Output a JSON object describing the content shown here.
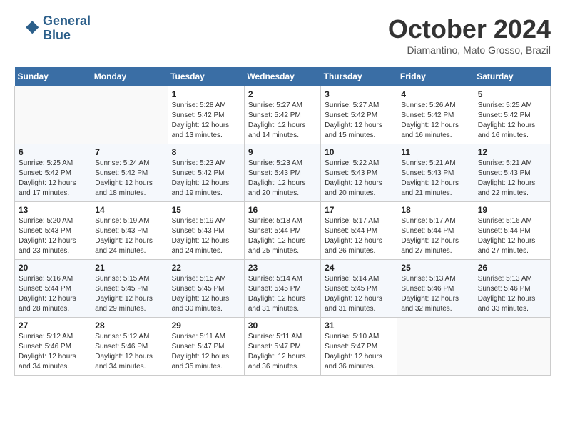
{
  "logo": {
    "line1": "General",
    "line2": "Blue"
  },
  "title": "October 2024",
  "location": "Diamantino, Mato Grosso, Brazil",
  "days_header": [
    "Sunday",
    "Monday",
    "Tuesday",
    "Wednesday",
    "Thursday",
    "Friday",
    "Saturday"
  ],
  "weeks": [
    [
      {
        "day": "",
        "info": ""
      },
      {
        "day": "",
        "info": ""
      },
      {
        "day": "1",
        "info": "Sunrise: 5:28 AM\nSunset: 5:42 PM\nDaylight: 12 hours and 13 minutes."
      },
      {
        "day": "2",
        "info": "Sunrise: 5:27 AM\nSunset: 5:42 PM\nDaylight: 12 hours and 14 minutes."
      },
      {
        "day": "3",
        "info": "Sunrise: 5:27 AM\nSunset: 5:42 PM\nDaylight: 12 hours and 15 minutes."
      },
      {
        "day": "4",
        "info": "Sunrise: 5:26 AM\nSunset: 5:42 PM\nDaylight: 12 hours and 16 minutes."
      },
      {
        "day": "5",
        "info": "Sunrise: 5:25 AM\nSunset: 5:42 PM\nDaylight: 12 hours and 16 minutes."
      }
    ],
    [
      {
        "day": "6",
        "info": "Sunrise: 5:25 AM\nSunset: 5:42 PM\nDaylight: 12 hours and 17 minutes."
      },
      {
        "day": "7",
        "info": "Sunrise: 5:24 AM\nSunset: 5:42 PM\nDaylight: 12 hours and 18 minutes."
      },
      {
        "day": "8",
        "info": "Sunrise: 5:23 AM\nSunset: 5:42 PM\nDaylight: 12 hours and 19 minutes."
      },
      {
        "day": "9",
        "info": "Sunrise: 5:23 AM\nSunset: 5:43 PM\nDaylight: 12 hours and 20 minutes."
      },
      {
        "day": "10",
        "info": "Sunrise: 5:22 AM\nSunset: 5:43 PM\nDaylight: 12 hours and 20 minutes."
      },
      {
        "day": "11",
        "info": "Sunrise: 5:21 AM\nSunset: 5:43 PM\nDaylight: 12 hours and 21 minutes."
      },
      {
        "day": "12",
        "info": "Sunrise: 5:21 AM\nSunset: 5:43 PM\nDaylight: 12 hours and 22 minutes."
      }
    ],
    [
      {
        "day": "13",
        "info": "Sunrise: 5:20 AM\nSunset: 5:43 PM\nDaylight: 12 hours and 23 minutes."
      },
      {
        "day": "14",
        "info": "Sunrise: 5:19 AM\nSunset: 5:43 PM\nDaylight: 12 hours and 24 minutes."
      },
      {
        "day": "15",
        "info": "Sunrise: 5:19 AM\nSunset: 5:43 PM\nDaylight: 12 hours and 24 minutes."
      },
      {
        "day": "16",
        "info": "Sunrise: 5:18 AM\nSunset: 5:44 PM\nDaylight: 12 hours and 25 minutes."
      },
      {
        "day": "17",
        "info": "Sunrise: 5:17 AM\nSunset: 5:44 PM\nDaylight: 12 hours and 26 minutes."
      },
      {
        "day": "18",
        "info": "Sunrise: 5:17 AM\nSunset: 5:44 PM\nDaylight: 12 hours and 27 minutes."
      },
      {
        "day": "19",
        "info": "Sunrise: 5:16 AM\nSunset: 5:44 PM\nDaylight: 12 hours and 27 minutes."
      }
    ],
    [
      {
        "day": "20",
        "info": "Sunrise: 5:16 AM\nSunset: 5:44 PM\nDaylight: 12 hours and 28 minutes."
      },
      {
        "day": "21",
        "info": "Sunrise: 5:15 AM\nSunset: 5:45 PM\nDaylight: 12 hours and 29 minutes."
      },
      {
        "day": "22",
        "info": "Sunrise: 5:15 AM\nSunset: 5:45 PM\nDaylight: 12 hours and 30 minutes."
      },
      {
        "day": "23",
        "info": "Sunrise: 5:14 AM\nSunset: 5:45 PM\nDaylight: 12 hours and 31 minutes."
      },
      {
        "day": "24",
        "info": "Sunrise: 5:14 AM\nSunset: 5:45 PM\nDaylight: 12 hours and 31 minutes."
      },
      {
        "day": "25",
        "info": "Sunrise: 5:13 AM\nSunset: 5:46 PM\nDaylight: 12 hours and 32 minutes."
      },
      {
        "day": "26",
        "info": "Sunrise: 5:13 AM\nSunset: 5:46 PM\nDaylight: 12 hours and 33 minutes."
      }
    ],
    [
      {
        "day": "27",
        "info": "Sunrise: 5:12 AM\nSunset: 5:46 PM\nDaylight: 12 hours and 34 minutes."
      },
      {
        "day": "28",
        "info": "Sunrise: 5:12 AM\nSunset: 5:46 PM\nDaylight: 12 hours and 34 minutes."
      },
      {
        "day": "29",
        "info": "Sunrise: 5:11 AM\nSunset: 5:47 PM\nDaylight: 12 hours and 35 minutes."
      },
      {
        "day": "30",
        "info": "Sunrise: 5:11 AM\nSunset: 5:47 PM\nDaylight: 12 hours and 36 minutes."
      },
      {
        "day": "31",
        "info": "Sunrise: 5:10 AM\nSunset: 5:47 PM\nDaylight: 12 hours and 36 minutes."
      },
      {
        "day": "",
        "info": ""
      },
      {
        "day": "",
        "info": ""
      }
    ]
  ]
}
